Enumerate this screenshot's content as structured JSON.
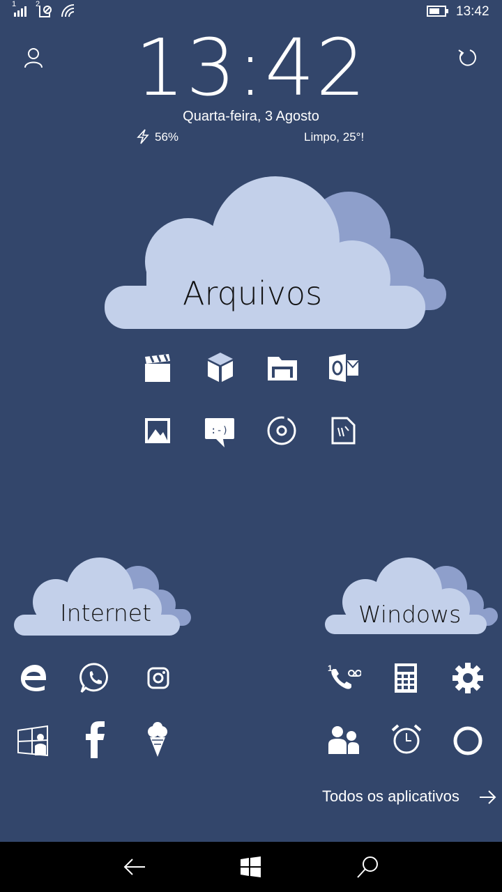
{
  "status_bar": {
    "sim1_label": "1",
    "sim2_label": "2",
    "time": "13:42",
    "icons": [
      "signal-icon",
      "sim2-no-signal-icon",
      "wifi-icon",
      "battery-icon"
    ]
  },
  "lock_info": {
    "big_time": "13:42",
    "date": "Quarta-feira, 3 Agosto",
    "battery_percent": "56%",
    "weather": "Limpo, 25°!"
  },
  "groups": {
    "files_label": "Arquivos",
    "internet_label": "Internet",
    "windows_label": "Windows"
  },
  "voicemail_badge": "1",
  "all_apps_label": "Todos os aplicativos",
  "colors": {
    "background": "#33466b",
    "cloud_light": "#c3d0ea",
    "cloud_dark": "#8e9fcb",
    "nav_bar": "#000000"
  }
}
